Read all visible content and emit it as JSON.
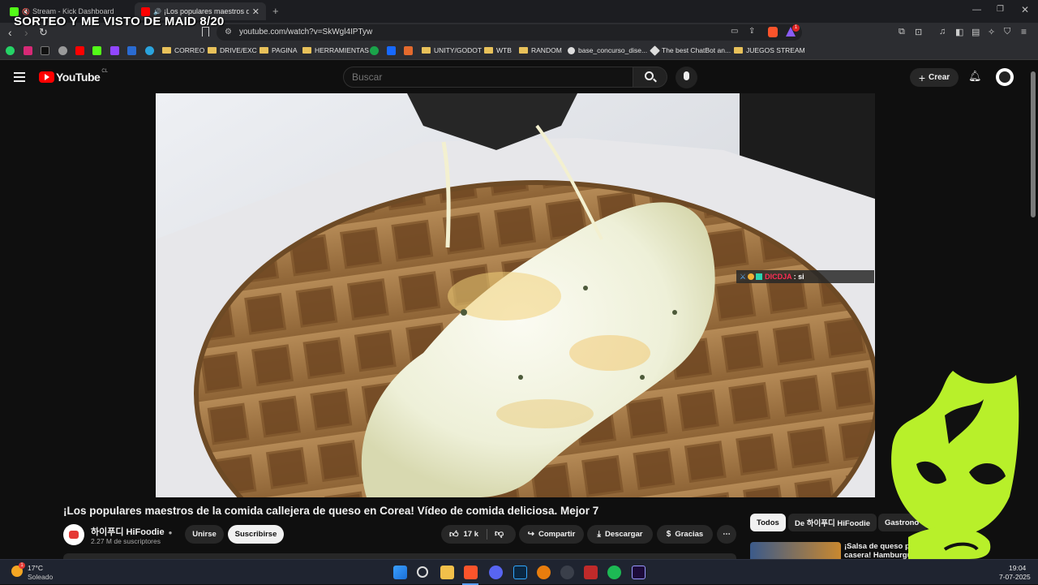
{
  "browser": {
    "tabs": [
      {
        "label": "Stream - Kick Dashboard"
      },
      {
        "label": "¡Los populares maestros de la"
      }
    ],
    "new_tab": "+",
    "url": "youtube.com/watch?v=SkWgl4IPTyw",
    "bookmarks": [
      {
        "label": "CORREO"
      },
      {
        "label": "DRIVE/EXC"
      },
      {
        "label": "PAGINA"
      },
      {
        "label": "HERRAMIENTAS"
      },
      {
        "label": "UNITY/GODOT"
      },
      {
        "label": "WTB"
      },
      {
        "label": "RANDOM"
      },
      {
        "label": "base_concurso_dise..."
      },
      {
        "label": "The best ChatBot an..."
      },
      {
        "label": "JUEGOS STREAM"
      }
    ],
    "brave_badge": "1"
  },
  "stream_overlay": {
    "title": "SORTEO Y ME VISTO DE MAID 8/20",
    "chat_user": "DICDJA",
    "chat_message": ": si"
  },
  "youtube": {
    "logo": "YouTube",
    "region": "CL",
    "search_placeholder": "Buscar",
    "create_label": "Crear",
    "video_title": "¡Los populares maestros de la comida callejera de queso en Corea! Vídeo de comida deliciosa. Mejor 7",
    "channel_name": "하이푸디 HiFoodie",
    "subscribers": "2.27 M de suscriptores",
    "join_label": "Unirse",
    "subscribe_label": "Suscribirse",
    "likes": "17 k",
    "share_label": "Compartir",
    "download_label": "Descargar",
    "thanks_label": "Gracias",
    "chips": [
      "Todos",
      "De 하이푸디 HiFoodie",
      "Gastrono"
    ],
    "related_title_1": "¡Salsa de queso profun",
    "related_title_2": "casera! Hamburgue"
  },
  "taskbar": {
    "weather_temp": "17°C",
    "weather_desc": "Soleado",
    "weather_badge": "1",
    "time": "19:04",
    "date": "7-07-2025"
  },
  "colors": {
    "yt_red": "#ff0000",
    "brave_orange": "#fb542b",
    "kick_green": "#53fc18",
    "mascot_green": "#b8f02a"
  }
}
